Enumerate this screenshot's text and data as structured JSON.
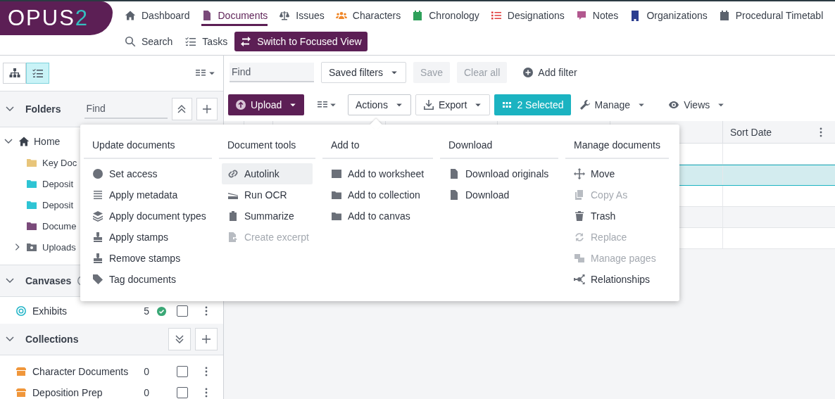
{
  "logo": {
    "text": "OPUS",
    "accent": "2"
  },
  "nav": [
    {
      "label": "Dashboard",
      "selected": false
    },
    {
      "label": "Documents",
      "selected": true
    },
    {
      "label": "Issues",
      "selected": false
    },
    {
      "label": "Characters",
      "selected": false
    },
    {
      "label": "Chronology",
      "selected": false
    },
    {
      "label": "Designations",
      "selected": false
    },
    {
      "label": "Notes",
      "selected": false
    },
    {
      "label": "Organizations",
      "selected": false
    },
    {
      "label": "Procedural Timetabl",
      "selected": false
    }
  ],
  "nav_secondary": [
    {
      "label": "Search"
    },
    {
      "label": "Tasks"
    }
  ],
  "focused_view_button": "Switch to Focused View",
  "sidebar": {
    "view_toggles": [
      {
        "selected": false
      },
      {
        "selected": true
      }
    ],
    "folders": {
      "title": "Folders",
      "expanded": true,
      "find_placeholder": "Find",
      "tree": [
        {
          "label": "Home",
          "expanded": true,
          "children": [
            {
              "label": "Key Doc",
              "kind": "folder",
              "color": "#e8c57a"
            },
            {
              "label": "Deposit",
              "kind": "folder",
              "color": "#2ec4d4"
            },
            {
              "label": "Deposit",
              "kind": "folder",
              "color": "#2ec4d4"
            },
            {
              "label": "Docume",
              "kind": "folder",
              "color": "#7a4a7a"
            },
            {
              "label": "Uploads",
              "kind": "uploads",
              "expanded": false
            }
          ]
        }
      ]
    },
    "canvases": {
      "title": "Canvases",
      "expanded": true,
      "items": [
        {
          "label": "Exhibits",
          "count": "5",
          "verified": true,
          "checked": false
        }
      ]
    },
    "collections": {
      "title": "Collections",
      "expanded": true,
      "items": [
        {
          "label": "Character Documents",
          "count": "0",
          "verified": false,
          "checked": false
        },
        {
          "label": "Deposition Prep",
          "count": "0",
          "verified": false,
          "checked": false
        }
      ]
    }
  },
  "filters": {
    "find_placeholder": "Find",
    "saved_filters": "Saved filters",
    "save": {
      "label": "Save",
      "disabled": true
    },
    "clear": {
      "label": "Clear all",
      "disabled": true
    },
    "add_filter": "Add filter"
  },
  "toolbar": {
    "upload": "Upload",
    "actions": {
      "label": "Actions",
      "expanded": true
    },
    "export": "Export",
    "selection": "2 Selected",
    "manage": "Manage",
    "views": "Views"
  },
  "table": {
    "last_column": "Sort Date",
    "rows": [
      {
        "selected": false
      },
      {
        "selected": true
      },
      {
        "selected": false
      },
      {
        "selected": false
      },
      {
        "selected": false
      }
    ]
  },
  "actions_menu": {
    "columns": [
      {
        "heading": "Update documents",
        "items": [
          {
            "label": "Set access",
            "disabled": false,
            "highlighted": false
          },
          {
            "label": "Apply metadata",
            "disabled": false,
            "highlighted": false
          },
          {
            "label": "Apply document types",
            "disabled": false,
            "highlighted": false
          },
          {
            "label": "Apply stamps",
            "disabled": false,
            "highlighted": false
          },
          {
            "label": "Remove stamps",
            "disabled": false,
            "highlighted": false
          },
          {
            "label": "Tag documents",
            "disabled": false,
            "highlighted": false
          }
        ]
      },
      {
        "heading": "Document tools",
        "items": [
          {
            "label": "Autolink",
            "disabled": false,
            "highlighted": true
          },
          {
            "label": "Run OCR",
            "disabled": false,
            "highlighted": false
          },
          {
            "label": "Summarize",
            "disabled": false,
            "highlighted": false
          },
          {
            "label": "Create excerpt",
            "disabled": true,
            "highlighted": false
          }
        ]
      },
      {
        "heading": "Add to",
        "items": [
          {
            "label": "Add to worksheet",
            "disabled": false,
            "highlighted": false
          },
          {
            "label": "Add to collection",
            "disabled": false,
            "highlighted": false
          },
          {
            "label": "Add to canvas",
            "disabled": false,
            "highlighted": false
          }
        ]
      },
      {
        "heading": "Download",
        "items": [
          {
            "label": "Download originals",
            "disabled": false,
            "highlighted": false
          },
          {
            "label": "Download",
            "disabled": false,
            "highlighted": false
          }
        ]
      },
      {
        "heading": "Manage documents",
        "items": [
          {
            "label": "Move",
            "disabled": false,
            "highlighted": false
          },
          {
            "label": "Copy As",
            "disabled": true,
            "highlighted": false
          },
          {
            "label": "Trash",
            "disabled": false,
            "highlighted": false
          },
          {
            "label": "Replace",
            "disabled": true,
            "highlighted": false
          },
          {
            "label": "Manage pages",
            "disabled": true,
            "highlighted": false
          },
          {
            "label": "Relationships",
            "disabled": false,
            "highlighted": false
          }
        ]
      }
    ]
  }
}
